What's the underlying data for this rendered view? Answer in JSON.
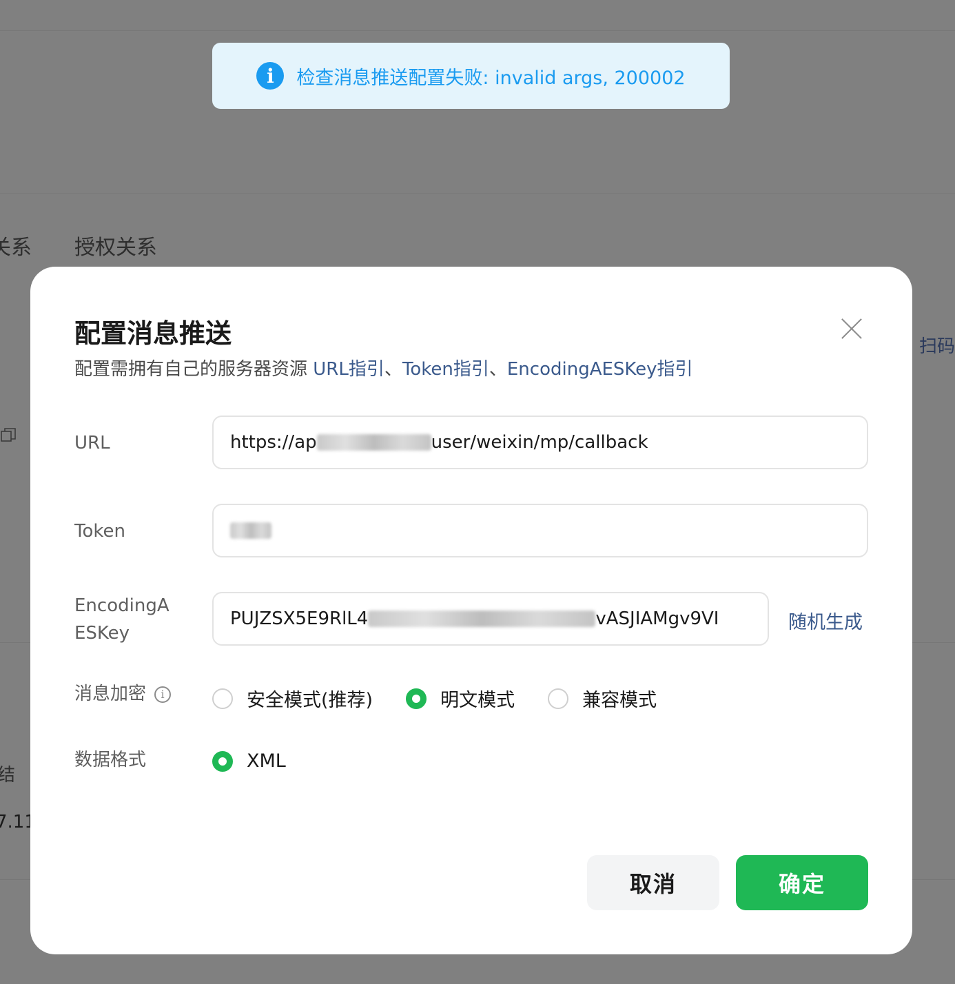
{
  "toast": {
    "icon": "info-icon",
    "message": "检查消息推送配置失败: invalid args, 200002",
    "color": "#1a9bf0"
  },
  "background": {
    "tab_left": "关系",
    "tab_auth": "授权关系",
    "scan": "扫码",
    "side_text": "结",
    "side_version": "7.11"
  },
  "modal": {
    "title": "配置消息推送",
    "subtitle": {
      "prefix": "配置需拥有自己的服务器资源 ",
      "link_url": "URL指引",
      "sep1": "、",
      "link_token": "Token指引",
      "sep2": "、",
      "link_aes": "EncodingAESKey指引"
    },
    "fields": {
      "url_label": "URL",
      "url_value_start": "https://ap",
      "url_value_end": "user/weixin/mp/callback",
      "token_label": "Token",
      "aes_label_line1": "EncodingA",
      "aes_label_line2": "ESKey",
      "aes_value_start": "PUJZSX5E9RlL4",
      "aes_value_end": "vASJIAMgv9VI",
      "random_generate": "随机生成"
    },
    "encryption": {
      "label": "消息加密",
      "options": [
        "安全模式(推荐)",
        "明文模式",
        "兼容模式"
      ],
      "selected": "明文模式"
    },
    "data_format": {
      "label": "数据格式",
      "options": [
        "XML"
      ],
      "selected": "XML"
    },
    "buttons": {
      "cancel": "取消",
      "confirm": "确定"
    },
    "colors": {
      "primary": "#1fb855",
      "link": "#3b5a8c"
    }
  }
}
